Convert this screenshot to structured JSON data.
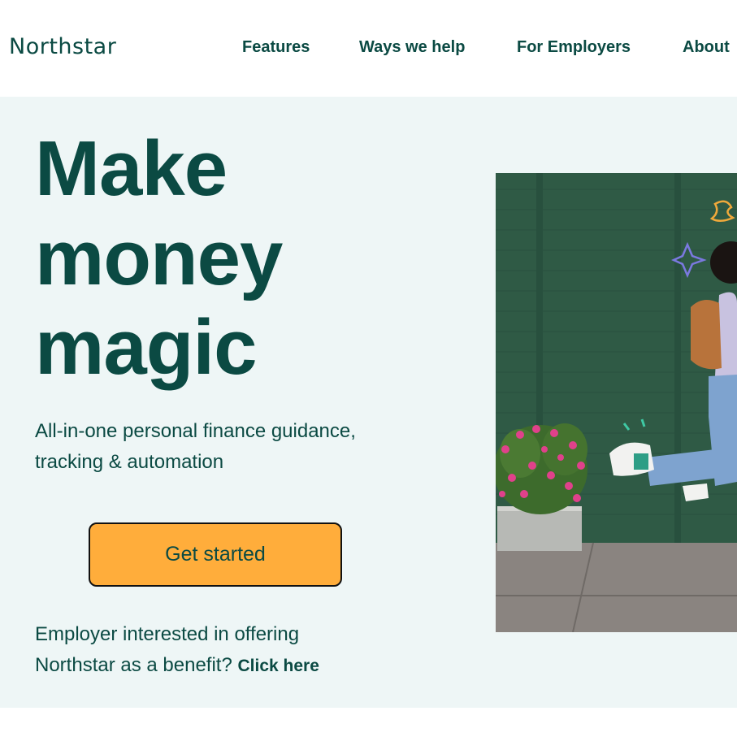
{
  "brand": {
    "name": "Northstar"
  },
  "nav": {
    "items": [
      {
        "label": "Features"
      },
      {
        "label": "Ways we help"
      },
      {
        "label": "For Employers"
      },
      {
        "label": "About"
      }
    ]
  },
  "hero": {
    "headline_line1": "Make",
    "headline_line2": "money",
    "headline_line3": "magic",
    "subtext": "All-in-one personal finance guidance, tracking & automation",
    "cta_label": "Get started",
    "employer_text": "Employer interested in offering Northstar as a benefit?",
    "employer_link": "Click here"
  },
  "colors": {
    "brand_dark": "#0b4a43",
    "hero_background": "#eef6f6",
    "cta_background": "#ffad3b",
    "photo_wall": "#2f5a45"
  },
  "icons": [
    "sparkle-icon",
    "swirl-icon"
  ]
}
